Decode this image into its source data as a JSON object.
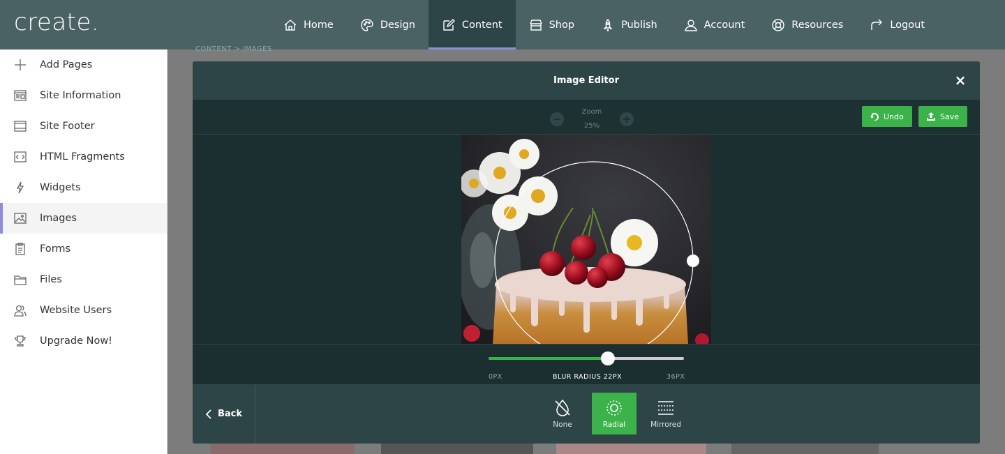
{
  "brand": {
    "logo": "create."
  },
  "nav": {
    "items": [
      {
        "label": "Home",
        "icon": "home-icon"
      },
      {
        "label": "Design",
        "icon": "palette-icon"
      },
      {
        "label": "Content",
        "icon": "edit-icon",
        "active": true
      },
      {
        "label": "Shop",
        "icon": "shop-icon"
      },
      {
        "label": "Publish",
        "icon": "rocket-icon"
      },
      {
        "label": "Account",
        "icon": "user-icon"
      },
      {
        "label": "Resources",
        "icon": "lifebuoy-icon"
      },
      {
        "label": "Logout",
        "icon": "logout-icon"
      }
    ]
  },
  "sidebar": {
    "items": [
      {
        "label": "Add Pages",
        "icon": "plus-icon"
      },
      {
        "label": "Site Information",
        "icon": "site-info-icon"
      },
      {
        "label": "Site Footer",
        "icon": "footer-icon"
      },
      {
        "label": "HTML Fragments",
        "icon": "code-icon"
      },
      {
        "label": "Widgets",
        "icon": "lightning-icon"
      },
      {
        "label": "Images",
        "icon": "image-icon",
        "active": true
      },
      {
        "label": "Forms",
        "icon": "clipboard-icon"
      },
      {
        "label": "Files",
        "icon": "folder-icon"
      },
      {
        "label": "Website Users",
        "icon": "users-icon"
      },
      {
        "label": "Upgrade Now!",
        "icon": "trophy-icon"
      }
    ]
  },
  "background": {
    "breadcrumb": "CONTENT  >  IMAGES"
  },
  "editor": {
    "title": "Image Editor",
    "close": "×",
    "zoom": {
      "label": "Zoom",
      "value": "25%",
      "minus": "−",
      "plus": "+"
    },
    "undo_label": "Undo",
    "save_label": "Save",
    "blur": {
      "min_label": "0PX",
      "max_label": "36PX",
      "value_label": "BLUR RADIUS 22PX",
      "value": 22,
      "min": 0,
      "max": 36
    },
    "back_label": "Back",
    "modes": [
      {
        "label": "None",
        "icon": "no-blur-icon"
      },
      {
        "label": "Radial",
        "icon": "radial-blur-icon",
        "active": true
      },
      {
        "label": "Mirrored",
        "icon": "mirrored-blur-icon"
      }
    ]
  },
  "colors": {
    "topbar": "#4a6264",
    "accent_green": "#3cb34a",
    "active_indicator": "#8c8fd8",
    "modal_bg": "#1f3234"
  }
}
